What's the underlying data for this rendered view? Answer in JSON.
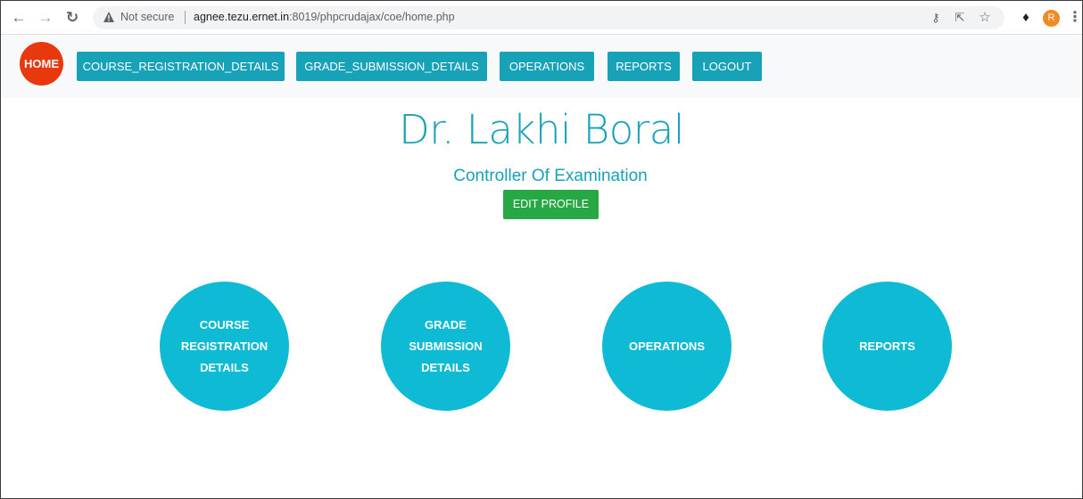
{
  "browser": {
    "back_icon": "arrow-left",
    "forward_icon": "arrow-right",
    "reload_icon": "reload",
    "security_label": "Not secure",
    "url_host": "agnee.tezu.ernet.in",
    "url_rest": ":8019/phpcrudajax/coe/home.php",
    "profile_initial": "R"
  },
  "nav": {
    "home": "HOME",
    "links": [
      "COURSE_REGISTRATION_DETAILS",
      "GRADE_SUBMISSION_DETAILS",
      "OPERATIONS",
      "REPORTS",
      "LOGOUT"
    ]
  },
  "profile": {
    "name": "Dr. Lakhi Boral",
    "role": "Controller Of Examination",
    "edit_label": "EDIT PROFILE"
  },
  "tiles": [
    {
      "lines": [
        "COURSE",
        "REGISTRATION",
        "DETAILS"
      ]
    },
    {
      "lines": [
        "GRADE",
        "SUBMISSION",
        "DETAILS"
      ]
    },
    {
      "lines": [
        "OPERATIONS"
      ]
    },
    {
      "lines": [
        "REPORTS"
      ]
    }
  ],
  "colors": {
    "accent": "#17a2b8",
    "home": "#e8390e",
    "edit": "#28a745",
    "tile": "#0fbbd4"
  }
}
